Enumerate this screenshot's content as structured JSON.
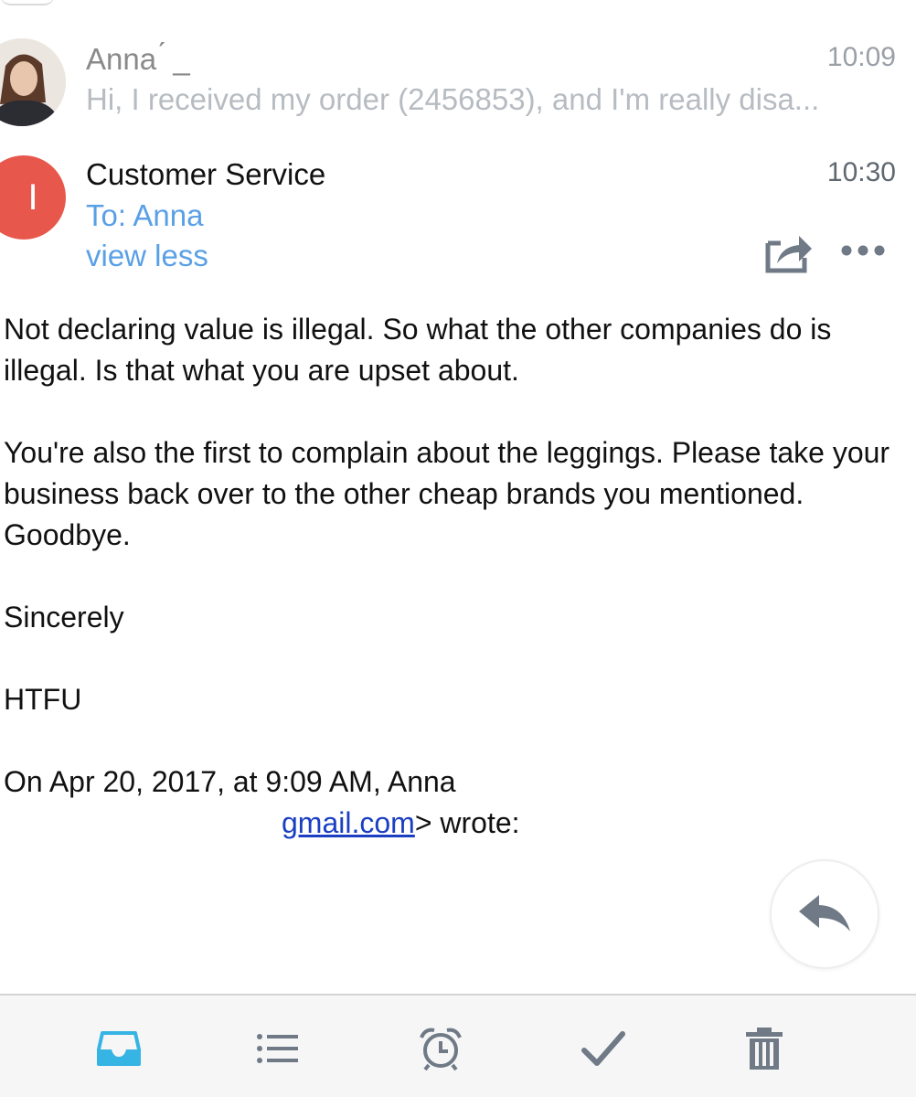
{
  "thread": {
    "messages": [
      {
        "sender": "Anna ́ _",
        "time": "10:09",
        "snippet": "Hi, I received my order (2456853), and I'm really disa..."
      },
      {
        "avatar_initial": "I",
        "sender": "Customer Service",
        "time": "10:30",
        "to": "To: Anna",
        "toggle_label": "view less",
        "body": {
          "paragraph1": "Not declaring value is illegal. So what the other companies do is illegal. Is that what you are upset about.",
          "paragraph2": "You're also the first to complain about the leggings. Please take your business back over to the other cheap brands you mentioned. Goodbye.",
          "signoff": "Sincerely",
          "signature": "HTFU",
          "quote_header": "On Apr 20, 2017, at 9:09 AM, Anna",
          "quote_email": "gmail.com",
          "quote_suffix": "> wrote:"
        }
      }
    ]
  },
  "icons": {
    "share": "share-icon",
    "more": "more-icon",
    "reply": "reply-icon",
    "inbox": "inbox-icon",
    "list": "list-icon",
    "snooze": "alarm-clock-icon",
    "done": "checkmark-icon",
    "trash": "trash-icon"
  },
  "colors": {
    "link_blue": "#5aa0e6",
    "avatar_red": "#e8574c",
    "inbox_active": "#36b4e3",
    "icon_gray": "#6f7a86",
    "hyperlink": "#1a3fc2"
  }
}
